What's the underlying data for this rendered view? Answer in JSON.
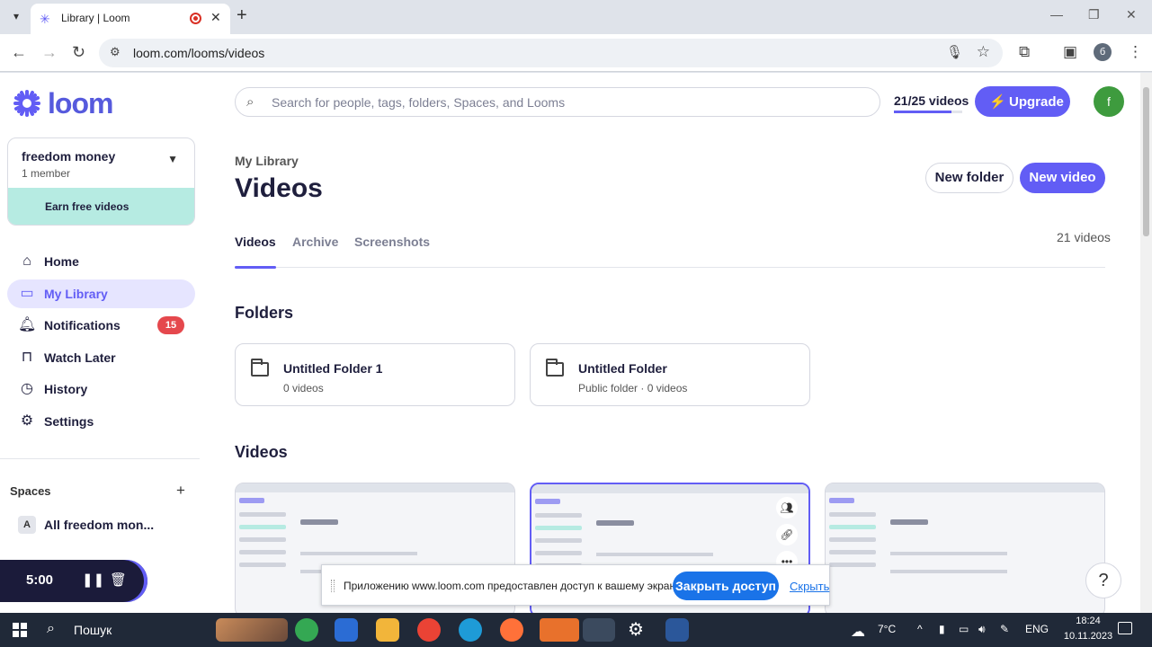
{
  "browser": {
    "tab_title": "Library | Loom",
    "url": "loom.com/looms/videos",
    "profile_initial": "б"
  },
  "sidebar": {
    "logo_text": "loom",
    "workspace": {
      "name": "freedom money",
      "members": "1 member",
      "earn_label": "Earn free videos"
    },
    "nav": [
      {
        "label": "Home",
        "icon": "home-icon"
      },
      {
        "label": "My Library",
        "icon": "library-icon",
        "active": true
      },
      {
        "label": "Notifications",
        "icon": "bell-icon",
        "badge": "15"
      },
      {
        "label": "Watch Later",
        "icon": "bookmark-icon"
      },
      {
        "label": "History",
        "icon": "clock-icon"
      },
      {
        "label": "Settings",
        "icon": "gear-icon"
      }
    ],
    "spaces_heading": "Spaces",
    "space_item": {
      "avatar": "A",
      "label": "All freedom mon..."
    }
  },
  "recorder": {
    "time": "5:00"
  },
  "header": {
    "search_placeholder": "Search for people, tags, folders, Spaces, and Looms",
    "quota": "21/25 videos",
    "quota_fraction": 0.84,
    "upgrade_label": "Upgrade",
    "avatar_initial": "f"
  },
  "main": {
    "breadcrumb": "My Library",
    "title": "Videos",
    "new_folder_label": "New folder",
    "new_video_label": "New video",
    "tabs": [
      {
        "label": "Videos",
        "active": true
      },
      {
        "label": "Archive"
      },
      {
        "label": "Screenshots"
      }
    ],
    "video_count": "21 videos",
    "folders_heading": "Folders",
    "folders": [
      {
        "name": "Untitled Folder 1",
        "meta": "0 videos"
      },
      {
        "name": "Untitled Folder",
        "meta": "Public folder · 0 videos"
      }
    ],
    "videos_heading": "Videos"
  },
  "share_notice": {
    "text": "Приложению www.loom.com предоставлен доступ к вашему экрану.",
    "stop_label": "Закрыть доступ",
    "hide_label": "Скрыть"
  },
  "taskbar": {
    "search_label": "Пошук",
    "weather": "7°C",
    "lang": "ENG",
    "time": "18:24",
    "date": "10.11.2023"
  },
  "colors": {
    "accent": "#625df5",
    "badge": "#e5484d",
    "earn_bg": "#b6ebe2",
    "share_button": "#1a73e8"
  }
}
